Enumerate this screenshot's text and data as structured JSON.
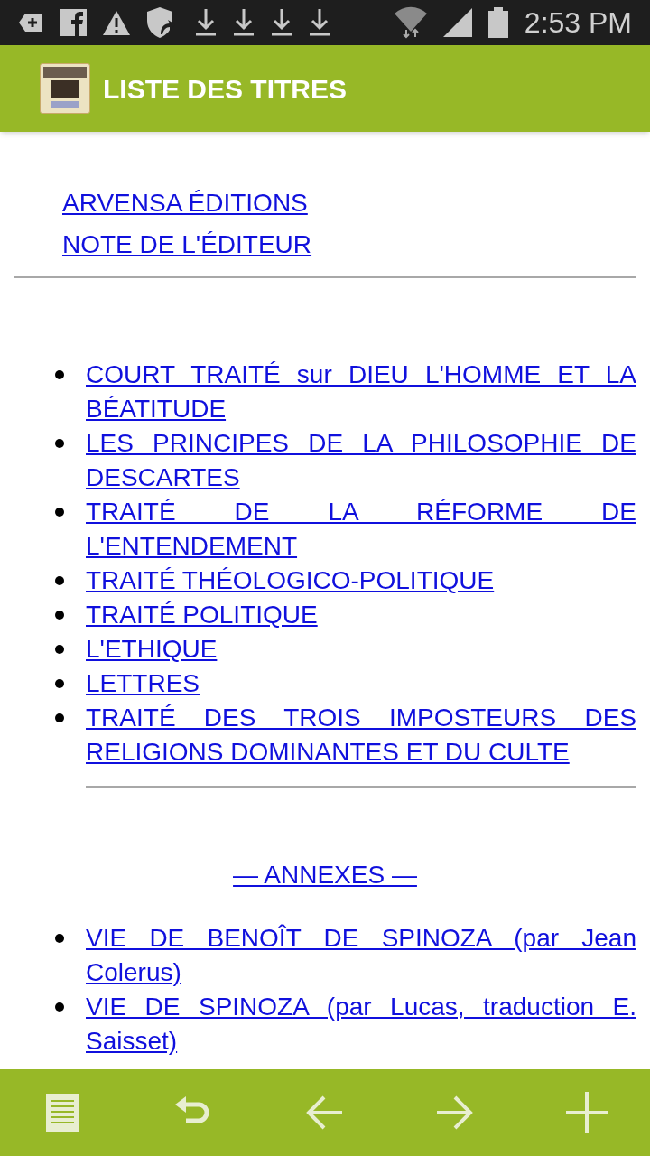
{
  "status_bar": {
    "time": "2:53 PM"
  },
  "app_bar": {
    "title": "LISTE DES TITRES"
  },
  "top_links": [
    "ARVENSA ÉDITIONS",
    "NOTE DE L'ÉDITEUR"
  ],
  "titles": [
    "COURT TRAITÉ sur DIEU L'HOMME ET LA BÉATITUDE",
    "LES PRINCIPES DE LA PHILOSOPHIE DE DESCARTES",
    "TRAITÉ DE LA RÉFORME DE L'ENTENDEMENT",
    "TRAITÉ THÉOLOGICO-POLITIQUE",
    "TRAITÉ POLITIQUE",
    "L'ETHIQUE",
    "LETTRES",
    "TRAITÉ DES TROIS IMPOSTEURS DES RELIGIONS DOMINANTES ET DU CULTE"
  ],
  "annexes": {
    "heading": "— ANNEXES —",
    "items": [
      "VIE DE BENOÎT DE SPINOZA (par Jean Colerus)",
      "VIE DE SPINOZA (par Lucas, traduction E. Saisset)"
    ]
  },
  "toolbar": [
    {
      "kind": "contents"
    },
    {
      "kind": "back"
    },
    {
      "kind": "previous"
    },
    {
      "kind": "next"
    },
    {
      "kind": "add"
    }
  ]
}
